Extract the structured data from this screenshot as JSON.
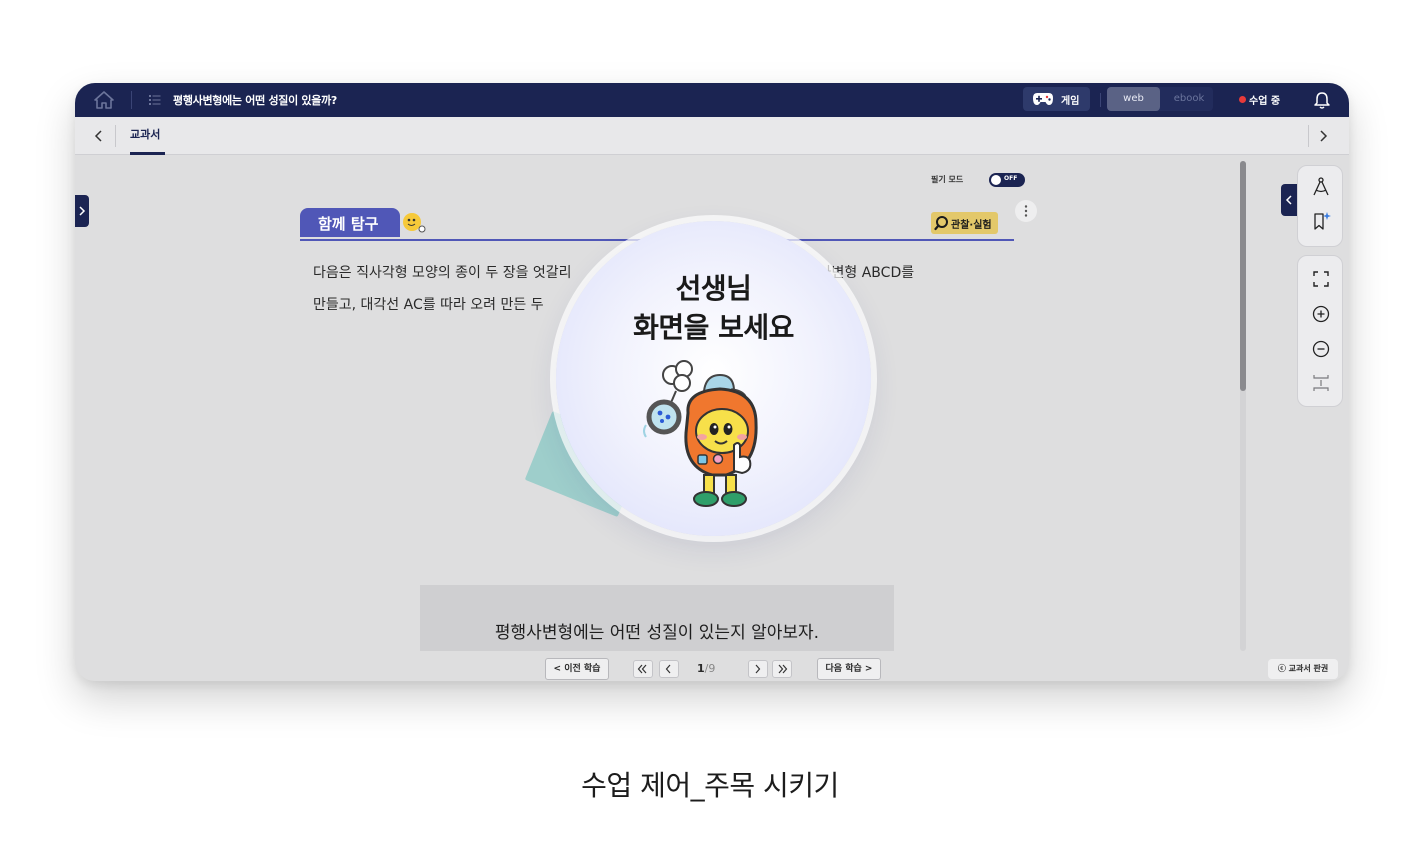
{
  "topbar": {
    "title": "평행사변형에는 어떤 성질이 있을까?",
    "game_label": "게임",
    "view_modes": [
      "web",
      "ebook"
    ],
    "active_view_mode": "web",
    "status_label": "수업 중",
    "status_color": "#e83a3a",
    "icons": [
      "home-icon",
      "list-icon",
      "gamepad-icon",
      "bell-icon"
    ]
  },
  "tabs": {
    "items": [
      "교과서"
    ],
    "active": "교과서"
  },
  "content": {
    "pen_mode_label": "필기 모드",
    "pen_mode_toggle": "OFF",
    "section_badge": "함께 탐구",
    "observe_tag": "관찰·실험",
    "paragraph_line1": "다음은 직사각형 모양의 종이 두 장을 엇갈리",
    "paragraph_line1_end": "겨 평행사변형 ABCD를",
    "paragraph_line2": "만들고, 대각선 AC를 따라 오려 만든 두",
    "learning_goal": "평행사변형에는 어떤 성질이 있는지 알아보자."
  },
  "pager": {
    "prev_lesson": "< 이전 학습",
    "next_lesson": "다음 학습 >",
    "current_page": "1",
    "separator": "/",
    "total_pages": "9",
    "copyright": "ⓒ 교과서 판권"
  },
  "tools": [
    "compass-icon",
    "ai-bookmark-icon",
    "fullscreen-icon",
    "zoom-in-icon",
    "zoom-out-icon",
    "fit-height-icon"
  ],
  "overlay": {
    "title_line1": "선생님",
    "title_line2": "화면을 보세요"
  },
  "caption": "수업 제어_주목 시키기",
  "colors": {
    "navy": "#1b2452",
    "accent_purple": "#5057b7",
    "tag_yellow": "#e3c86a",
    "mascot_orange": "#f0772e"
  }
}
